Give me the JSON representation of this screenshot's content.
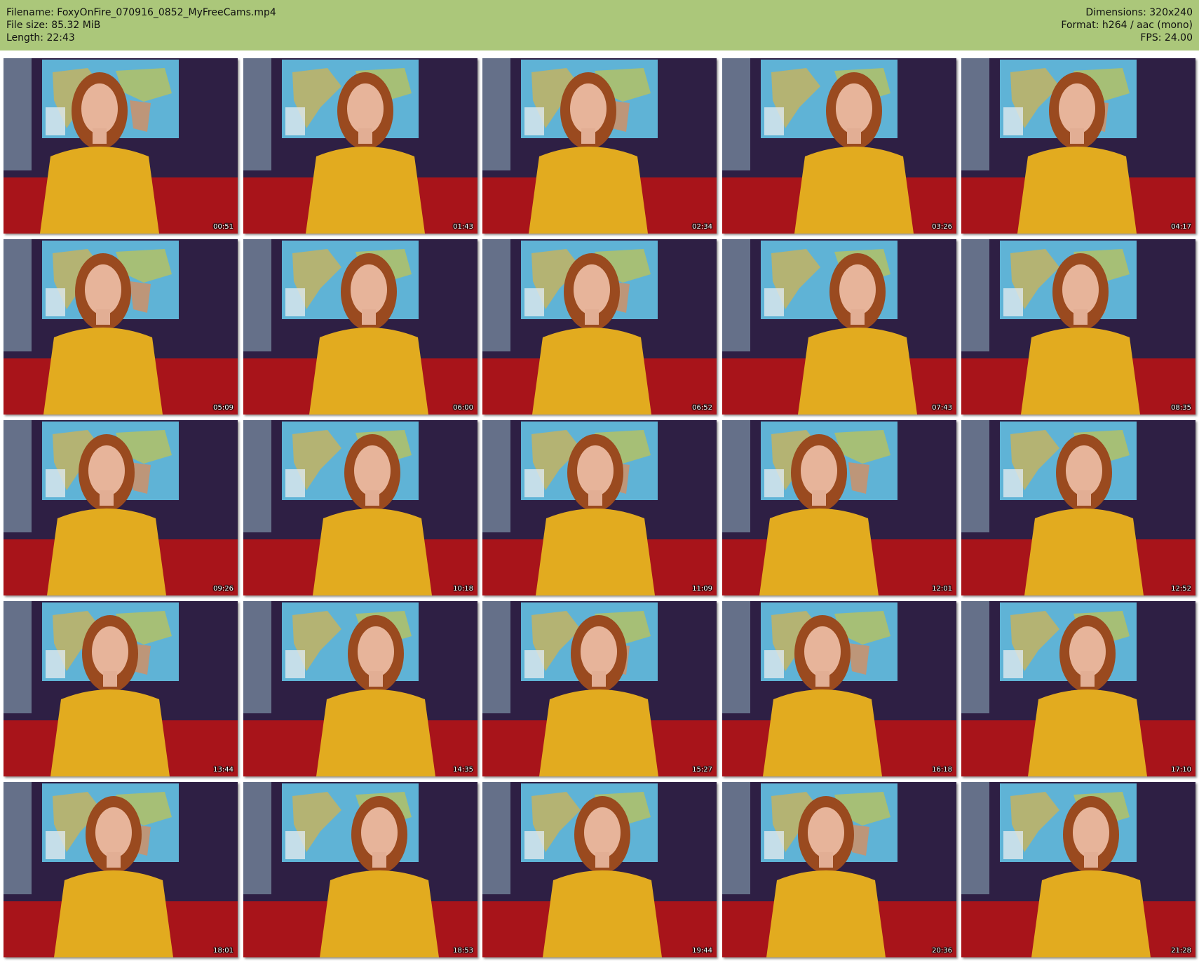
{
  "header": {
    "filename": "Filename: FoxyOnFire_070916_0852_MyFreeCams.mp4",
    "file_size": "File size: 85.32 MiB",
    "length": "Length: 22:43",
    "dimensions": "Dimensions: 320x240",
    "format": "Format: h264 / aac (mono)",
    "fps": "FPS: 24.00"
  },
  "colors": {
    "header_bg": "#abc77a",
    "shirt": "#e2ab1f",
    "couch": "#a8141a",
    "backdrop": "#2e1f44",
    "map_water": "#5fb3d6"
  },
  "thumbnails": [
    {
      "timestamp": "00:51",
      "icon": "video-frame-thumbnail"
    },
    {
      "timestamp": "01:43",
      "icon": "video-frame-thumbnail"
    },
    {
      "timestamp": "02:34",
      "icon": "video-frame-thumbnail"
    },
    {
      "timestamp": "03:26",
      "icon": "video-frame-thumbnail"
    },
    {
      "timestamp": "04:17",
      "icon": "video-frame-thumbnail"
    },
    {
      "timestamp": "05:09",
      "icon": "video-frame-thumbnail"
    },
    {
      "timestamp": "06:00",
      "icon": "video-frame-thumbnail"
    },
    {
      "timestamp": "06:52",
      "icon": "video-frame-thumbnail"
    },
    {
      "timestamp": "07:43",
      "icon": "video-frame-thumbnail"
    },
    {
      "timestamp": "08:35",
      "icon": "video-frame-thumbnail"
    },
    {
      "timestamp": "09:26",
      "icon": "video-frame-thumbnail"
    },
    {
      "timestamp": "10:18",
      "icon": "video-frame-thumbnail"
    },
    {
      "timestamp": "11:09",
      "icon": "video-frame-thumbnail"
    },
    {
      "timestamp": "12:01",
      "icon": "video-frame-thumbnail"
    },
    {
      "timestamp": "12:52",
      "icon": "video-frame-thumbnail"
    },
    {
      "timestamp": "13:44",
      "icon": "video-frame-thumbnail"
    },
    {
      "timestamp": "14:35",
      "icon": "video-frame-thumbnail"
    },
    {
      "timestamp": "15:27",
      "icon": "video-frame-thumbnail"
    },
    {
      "timestamp": "16:18",
      "icon": "video-frame-thumbnail"
    },
    {
      "timestamp": "17:10",
      "icon": "video-frame-thumbnail"
    },
    {
      "timestamp": "18:01",
      "icon": "video-frame-thumbnail"
    },
    {
      "timestamp": "18:53",
      "icon": "video-frame-thumbnail"
    },
    {
      "timestamp": "19:44",
      "icon": "video-frame-thumbnail"
    },
    {
      "timestamp": "20:36",
      "icon": "video-frame-thumbnail"
    },
    {
      "timestamp": "21:28",
      "icon": "video-frame-thumbnail"
    }
  ]
}
